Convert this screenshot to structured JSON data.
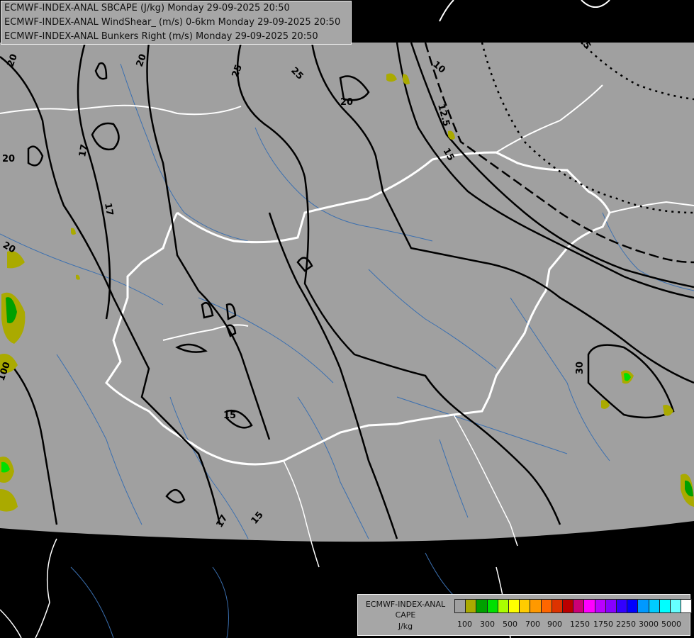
{
  "header": {
    "line1": "ECMWF-INDEX-ANAL SBCAPE (J/kg) Monday 29-09-2025 20:50",
    "line2": "ECMWF-INDEX-ANAL WindShear_ (m/s) 0-6km Monday 29-09-2025 20:50",
    "line3": "ECMWF-INDEX-ANAL Bunkers Right (m/s) Monday 29-09-2025 20:50"
  },
  "legend": {
    "title1": "ECMWF-INDEX-ANAL",
    "title2": "CAPE",
    "title3": "J/kg",
    "colors": [
      "#a0a0a0",
      "#aaaa00",
      "#00a000",
      "#00e000",
      "#aaff00",
      "#ffff00",
      "#ffcc00",
      "#ff9900",
      "#ff6600",
      "#dd3300",
      "#bb0000",
      "#cc0077",
      "#ff00ff",
      "#bb00ff",
      "#8800ff",
      "#3300ff",
      "#0000ff",
      "#0099ff",
      "#00ccff",
      "#00ffff",
      "#66ffff",
      "#ffffff"
    ],
    "ticks": [
      "100",
      "300",
      "500",
      "700",
      "900",
      "1250",
      "1750",
      "2250",
      "3000",
      "5000"
    ]
  },
  "contour_labels": {
    "l20a": "20",
    "l20b": "20",
    "l20c": "20",
    "l20d": "20",
    "l20e": "20",
    "l25a": "25",
    "l25b": "25",
    "l17a": "17",
    "l17b": "17",
    "l17c": "17",
    "l15a": "15",
    "l15b": "15",
    "l15c": "15",
    "l10": "10",
    "l125": "12.5",
    "l5": "5",
    "l30": "30",
    "l100": "100"
  },
  "colors": {
    "domain_fill": "#a0a0a0",
    "background": "#000000",
    "borders": "#ffffff",
    "rivers": "#3a6fb0",
    "contours": "#000000",
    "cape_100": "#aaaa00",
    "cape_300": "#00a000",
    "cape_500": "#00e000"
  }
}
